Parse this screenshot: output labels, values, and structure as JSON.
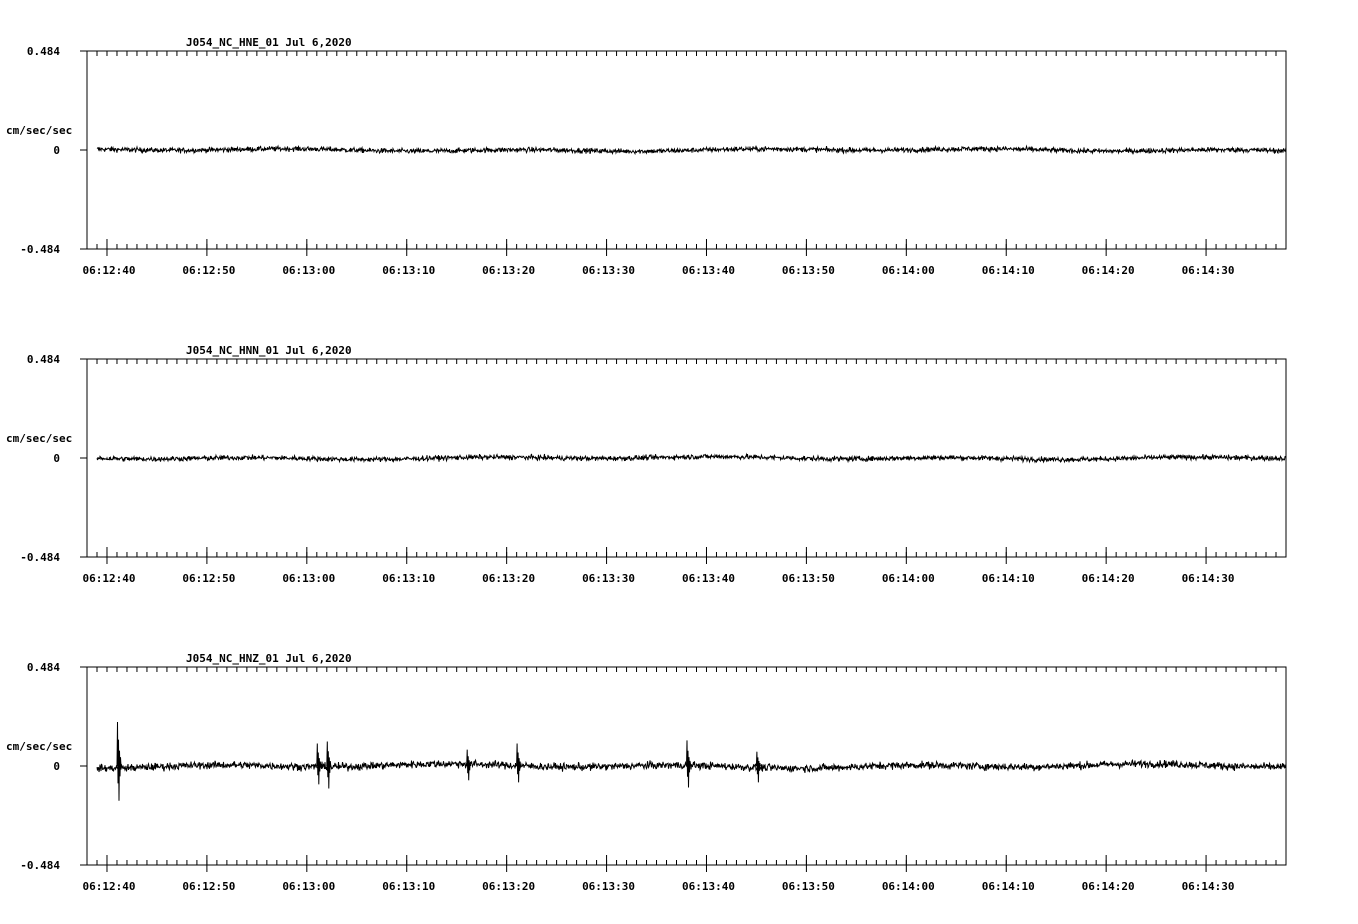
{
  "chart_data": [
    {
      "type": "line",
      "title": "J054_NC_HNE_01   Jul 6,2020",
      "ylabel": "cm/sec/sec",
      "ylim": [
        -0.484,
        0.484
      ],
      "y_ticks": [
        "0.484",
        "0",
        "-0.484"
      ],
      "x_tick_labels": [
        "06:12:40",
        "06:12:50",
        "06:13:00",
        "06:13:10",
        "06:13:20",
        "06:13:30",
        "06:13:40",
        "06:13:50",
        "06:14:00",
        "06:14:10",
        "06:14:20",
        "06:14:30"
      ],
      "x_start": "06:12:38",
      "x_end": "06:14:38",
      "series": [
        {
          "noise_amplitude": 0.012,
          "spikes": []
        }
      ]
    },
    {
      "type": "line",
      "title": "J054_NC_HNN_01   Jul 6,2020",
      "ylabel": "cm/sec/sec",
      "ylim": [
        -0.484,
        0.484
      ],
      "y_ticks": [
        "0.484",
        "0",
        "-0.484"
      ],
      "x_tick_labels": [
        "06:12:40",
        "06:12:50",
        "06:13:00",
        "06:13:10",
        "06:13:20",
        "06:13:30",
        "06:13:40",
        "06:13:50",
        "06:14:00",
        "06:14:10",
        "06:14:20",
        "06:14:30"
      ],
      "x_start": "06:12:38",
      "x_end": "06:14:38",
      "series": [
        {
          "noise_amplitude": 0.012,
          "spikes": []
        }
      ]
    },
    {
      "type": "line",
      "title": "J054_NC_HNZ_01   Jul 6,2020",
      "ylabel": "cm/sec/sec",
      "ylim": [
        -0.484,
        0.484
      ],
      "y_ticks": [
        "0.484",
        "0",
        "-0.484"
      ],
      "x_tick_labels": [
        "06:12:40",
        "06:12:50",
        "06:13:00",
        "06:13:10",
        "06:13:20",
        "06:13:30",
        "06:13:40",
        "06:13:50",
        "06:14:00",
        "06:14:10",
        "06:14:20",
        "06:14:30"
      ],
      "x_start": "06:12:38",
      "x_end": "06:14:38",
      "series": [
        {
          "noise_amplitude": 0.018,
          "spikes": [
            {
              "t": "06:12:41",
              "max": 0.215,
              "min": -0.17
            },
            {
              "t": "06:13:01",
              "max": 0.11,
              "min": -0.09
            },
            {
              "t": "06:13:02",
              "max": 0.12,
              "min": -0.11
            },
            {
              "t": "06:13:16",
              "max": 0.08,
              "min": -0.07
            },
            {
              "t": "06:13:21",
              "max": 0.11,
              "min": -0.08
            },
            {
              "t": "06:13:38",
              "max": 0.125,
              "min": -0.105
            },
            {
              "t": "06:13:45",
              "max": 0.07,
              "min": -0.08
            }
          ]
        }
      ]
    }
  ]
}
